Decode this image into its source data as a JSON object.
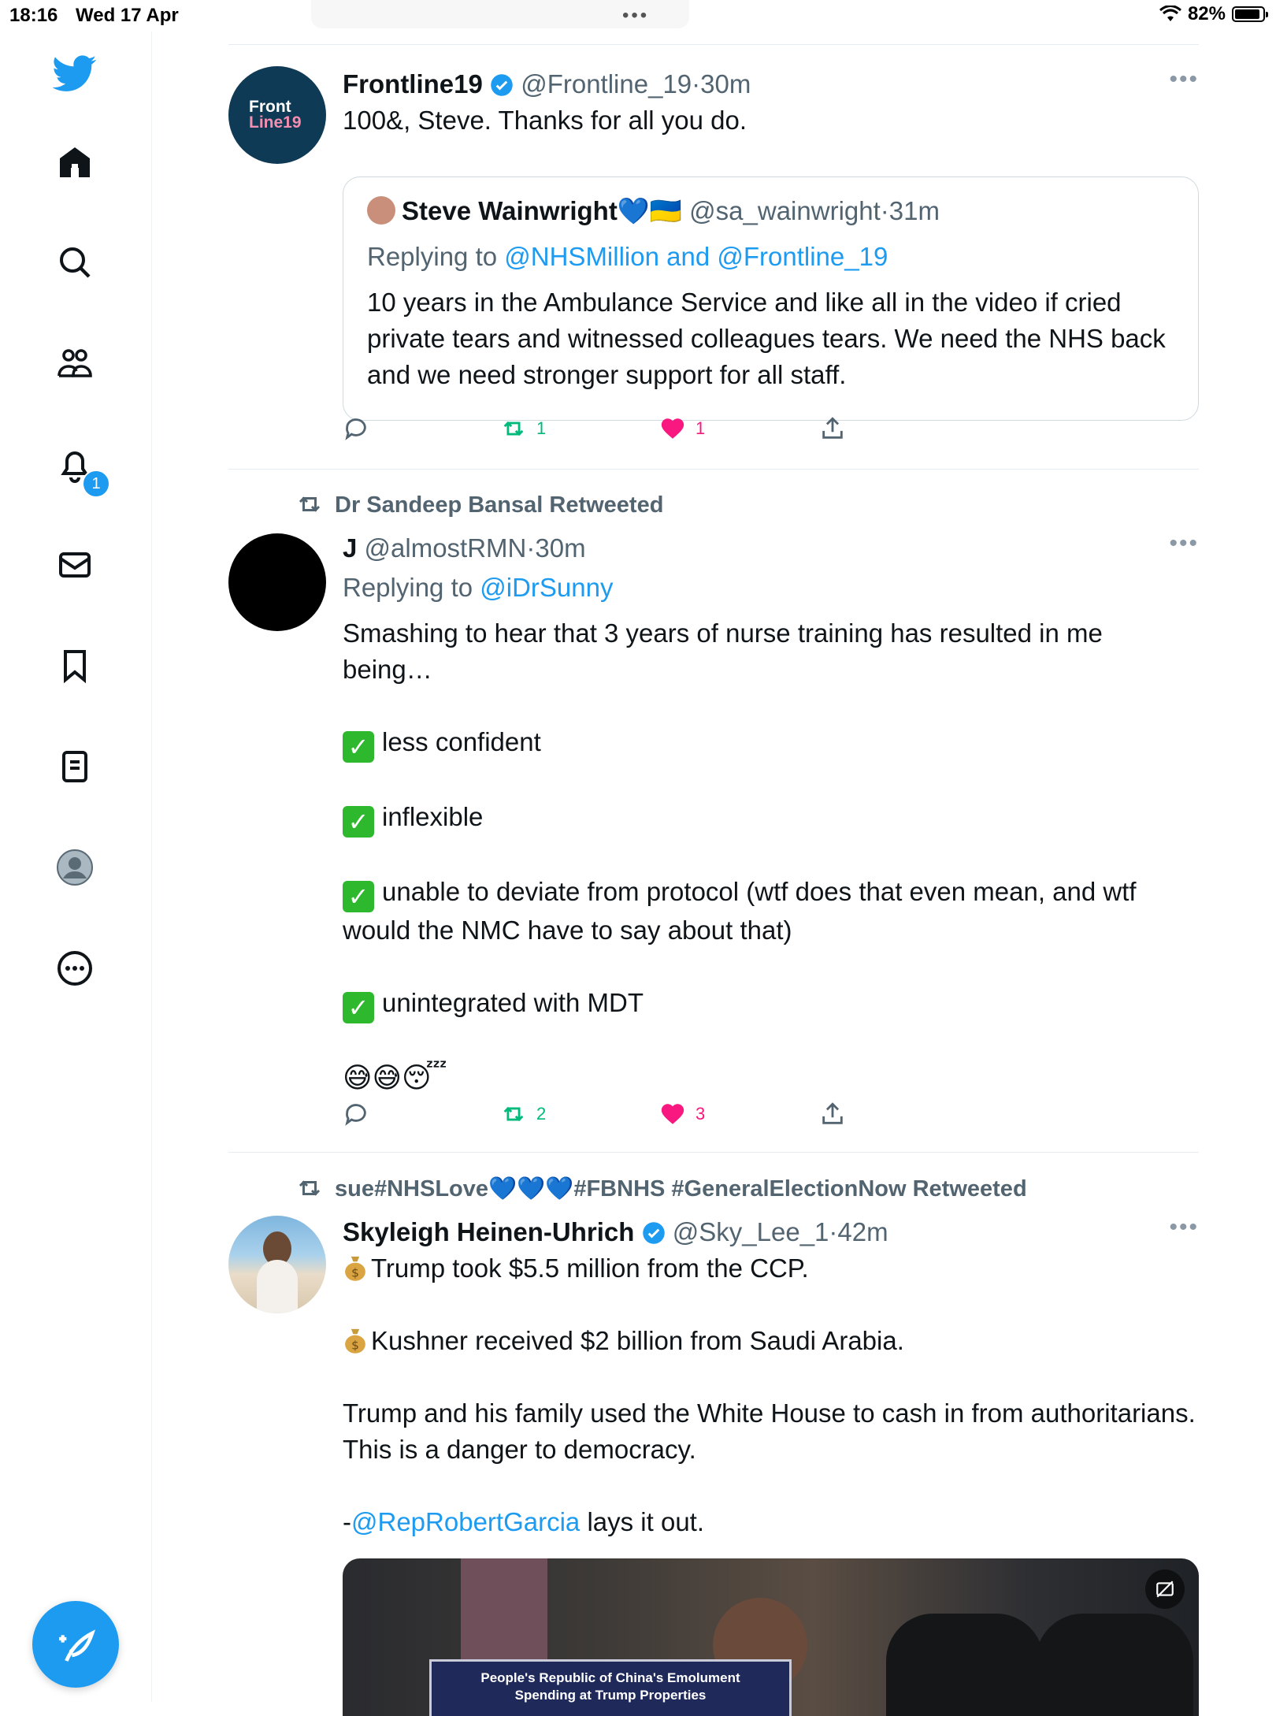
{
  "status_bar": {
    "time": "18:16",
    "date": "Wed 17 Apr",
    "battery": "82%",
    "battery_level": 0.82
  },
  "sidebar": {
    "items": [
      "twitter-logo",
      "home",
      "explore",
      "communities",
      "notifications",
      "messages",
      "bookmarks",
      "lists",
      "profile",
      "more"
    ],
    "notification_count": "1"
  },
  "tweets": [
    {
      "name": "Frontline19",
      "handle": "@Frontline_19",
      "sep": "·",
      "time": "30m",
      "avatar_text_1": "Front",
      "avatar_text_2": "Line19",
      "text": "100&, Steve. Thanks for all you do.",
      "quote": {
        "name": "Steve Wainwright💙🇺🇦",
        "handle": "@sa_wainwright",
        "sep": "·",
        "time": "31m",
        "replying_prefix": "Replying to ",
        "replying_to": "@NHSMillion and @Frontline_19",
        "text": "10 years in the Ambulance Service and like all in the video if cried private tears and witnessed colleagues tears. We need the NHS back and we need stronger support for all staff."
      },
      "retweets": "1",
      "likes": "1"
    },
    {
      "retweeted_by": "Dr Sandeep Bansal Retweeted",
      "name": "J",
      "handle": "@almostRMN",
      "sep": "·",
      "time": "30m",
      "replying_prefix": "Replying to ",
      "replying_to": "@iDrSunny",
      "text_intro": "Smashing to hear that 3 years of nurse training has resulted in me being…",
      "checklist": [
        "less confident",
        "inflexible",
        "unable to deviate from protocol (wtf does that even mean, and wtf would the NMC have to say about that)",
        "unintegrated with MDT"
      ],
      "check_glyph": "✓",
      "emojis": "😅😅😴",
      "retweets": "2",
      "likes": "3"
    },
    {
      "retweeted_by": "sue#NHSLove💙💙💙#FBNHS #GeneralElectionNow Retweeted",
      "name": "Skyleigh Heinen-Uhrich",
      "handle": "@Sky_Lee_1",
      "sep": "·",
      "time": "42m",
      "line1": "Trump took $5.5 million from the CCP.",
      "line2": "Kushner received $2 billion from Saudi Arabia.",
      "line3": "Trump and his family used the White House to cash in from authoritarians. This is a danger to democracy.",
      "line4_prefix": "-",
      "line4_link": "@RepRobertGarcia",
      "line4_suffix": " lays it out.",
      "media_caption_1": "People's Republic of China's Emolument",
      "media_caption_2": "Spending at Trump Properties"
    }
  ],
  "more_glyph": "•••",
  "colors": {
    "accent": "#1d9bf0",
    "retweet": "#00ba7c",
    "like": "#f91880",
    "muted": "#536471"
  }
}
